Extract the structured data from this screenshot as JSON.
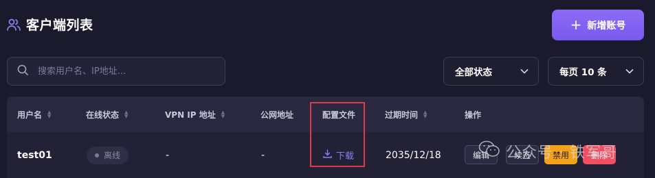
{
  "header": {
    "title": "客户端列表",
    "title_icon": "users-icon",
    "add_button_label": "新增账号",
    "add_button_icon": "plus-icon"
  },
  "filters": {
    "search_placeholder": "搜索用户名、IP地址...",
    "search_value": "",
    "status_select": "全部状态",
    "page_size_select": "每页 10 条"
  },
  "table": {
    "columns": [
      "用户名",
      "在线状态",
      "VPN IP 地址",
      "公网地址",
      "配置文件",
      "过期时间",
      "操作"
    ],
    "rows": [
      {
        "username": "test01",
        "status": "离线",
        "vpn_ip": "-",
        "public_ip": "-",
        "config_action": "下载",
        "expire": "2035/12/18",
        "actions": [
          "编辑",
          "续签",
          "禁用",
          "删除"
        ]
      }
    ]
  },
  "watermark": {
    "text": "公众号 · 铁军哥",
    "icon": "wechat-icon"
  },
  "colors": {
    "background": "#1b1a2c",
    "accent": "#7a5af0",
    "highlight_border": "#e0394a",
    "disable_button": "#f5a21b",
    "delete_button": "#ef4f5f"
  }
}
